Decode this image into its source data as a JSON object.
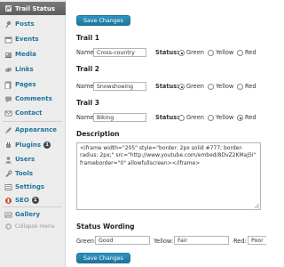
{
  "sidebar": {
    "items": [
      {
        "label": "Trail Status",
        "icon": "trail-icon",
        "active": true
      },
      {
        "label": "Posts",
        "icon": "pin-icon"
      },
      {
        "label": "Events",
        "icon": "events-icon"
      },
      {
        "label": "Media",
        "icon": "media-icon"
      },
      {
        "label": "Links",
        "icon": "links-icon"
      },
      {
        "label": "Pages",
        "icon": "pages-icon"
      },
      {
        "label": "Comments",
        "icon": "comments-icon"
      },
      {
        "label": "Contact",
        "icon": "contact-icon"
      },
      {
        "label": "Appearance",
        "icon": "appearance-icon"
      },
      {
        "label": "Plugins",
        "icon": "plugins-icon",
        "badge": "1"
      },
      {
        "label": "Users",
        "icon": "users-icon"
      },
      {
        "label": "Tools",
        "icon": "tools-icon"
      },
      {
        "label": "Settings",
        "icon": "settings-icon"
      },
      {
        "label": "SEO",
        "icon": "seo-icon",
        "badge": "1"
      },
      {
        "label": "Gallery",
        "icon": "gallery-icon"
      }
    ],
    "collapse_label": "Collapse menu"
  },
  "buttons": {
    "save_top": "Save Changes",
    "save_bottom": "Save Changes"
  },
  "trails": [
    {
      "title": "Trail 1",
      "name_label": "Name:",
      "name_value": "Cross-country",
      "status_label": "Status:",
      "selected": "Green"
    },
    {
      "title": "Trail 2",
      "name_label": "Name:",
      "name_value": "Snowshoeing",
      "status_label": "Status:",
      "selected": "Green"
    },
    {
      "title": "Trail 3",
      "name_label": "Name:",
      "name_value": "Biking",
      "status_label": "Status:",
      "selected": "Red"
    }
  ],
  "status_options": [
    "Green",
    "Yellow",
    "Red"
  ],
  "description": {
    "title": "Description",
    "value": "<iframe width=\"205\" style=\"border: 2px solid #777; border-radius: 2px;\" src=\"http://www.youtube.com/embed/8DvZ2KMaJ5I\" frameborder=\"0\" allowfullscreen></iframe>"
  },
  "status_wording": {
    "title": "Status Wording",
    "green_label": "Green:",
    "green_value": "Good",
    "yellow_label": "Yellow:",
    "yellow_value": "Fair",
    "red_label": "Red:",
    "red_value": "Poor"
  },
  "colors": {
    "accent": "#21759b",
    "sidebar_bg": "#ececec",
    "active_bg": "#6d6d6d"
  }
}
